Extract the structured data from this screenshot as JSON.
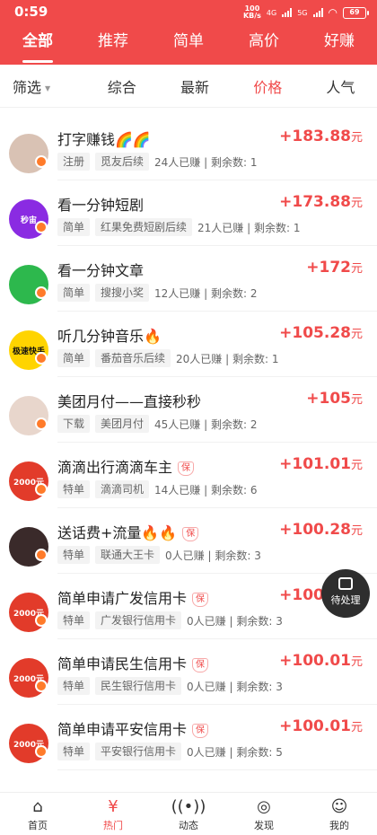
{
  "status": {
    "time": "0:59",
    "speed": "100",
    "speed_unit": "KB/s",
    "net1": "4G",
    "net2": "5G",
    "battery": "69"
  },
  "top_tabs": [
    "全部",
    "推荐",
    "简单",
    "高价",
    "好赚"
  ],
  "filters": [
    "筛选",
    "综合",
    "最新",
    "价格",
    "人气"
  ],
  "tasks": [
    {
      "title": "打字赚钱🌈🌈",
      "amount": "+183.88",
      "unit": "元",
      "tags": [
        "注册",
        "觅友后续"
      ],
      "stats": "24人已赚 | 剩余数: 1",
      "bao": false,
      "avatar_color": "#d9c2b4"
    },
    {
      "title": "看一分钟短剧",
      "amount": "+173.88",
      "unit": "元",
      "tags": [
        "简单",
        "红果免费短剧后续"
      ],
      "stats": "21人已赚 | 剩余数: 1",
      "bao": false,
      "avatar_color": "#8a2be2",
      "avatar_text": "秒宙"
    },
    {
      "title": "看一分钟文章",
      "amount": "+172",
      "unit": "元",
      "tags": [
        "简单",
        "搜搜小奖"
      ],
      "stats": "12人已赚 | 剩余数: 2",
      "bao": false,
      "avatar_color": "#2db84d"
    },
    {
      "title": "听几分钟音乐🔥",
      "amount": "+105.28",
      "unit": "元",
      "tags": [
        "简单",
        "番茄音乐后续"
      ],
      "stats": "20人已赚 | 剩余数: 1",
      "bao": false,
      "avatar_color": "#ffd400",
      "avatar_text": "极速快手"
    },
    {
      "title": "美团月付——直接秒秒",
      "amount": "+105",
      "unit": "元",
      "tags": [
        "下载",
        "美团月付"
      ],
      "stats": "45人已赚 | 剩余数: 2",
      "bao": false,
      "avatar_color": "#e8d6cc"
    },
    {
      "title": "滴滴出行滴滴车主",
      "amount": "+101.01",
      "unit": "元",
      "tags": [
        "特单",
        "滴滴司机"
      ],
      "stats": "14人已赚 | 剩余数: 6",
      "bao": true,
      "avatar_color": "#e23b2a",
      "avatar_text": "2000元"
    },
    {
      "title": "送话费+流量🔥🔥",
      "amount": "+100.28",
      "unit": "元",
      "tags": [
        "特单",
        "联通大王卡"
      ],
      "stats": "0人已赚 | 剩余数: 3",
      "bao": true,
      "avatar_color": "#3a2a2a"
    },
    {
      "title": "简单申请广发信用卡",
      "amount": "+100.01",
      "unit": "元",
      "tags": [
        "特单",
        "广发银行信用卡"
      ],
      "stats": "0人已赚 | 剩余数: 3",
      "bao": true,
      "avatar_color": "#e23b2a",
      "avatar_text": "2000元"
    },
    {
      "title": "简单申请民生信用卡",
      "amount": "+100.01",
      "unit": "元",
      "tags": [
        "特单",
        "民生银行信用卡"
      ],
      "stats": "0人已赚 | 剩余数: 3",
      "bao": true,
      "avatar_color": "#e23b2a",
      "avatar_text": "2000元"
    },
    {
      "title": "简单申请平安信用卡",
      "amount": "+100.01",
      "unit": "元",
      "tags": [
        "特单",
        "平安银行信用卡"
      ],
      "stats": "0人已赚 | 剩余数: 5",
      "bao": true,
      "avatar_color": "#e23b2a",
      "avatar_text": "2000元"
    }
  ],
  "bao_label": "保",
  "fab_label": "待处理",
  "bottom_nav": [
    "首页",
    "热门",
    "动态",
    "发现",
    "我的"
  ],
  "colors": {
    "accent": "#f04a4a"
  }
}
